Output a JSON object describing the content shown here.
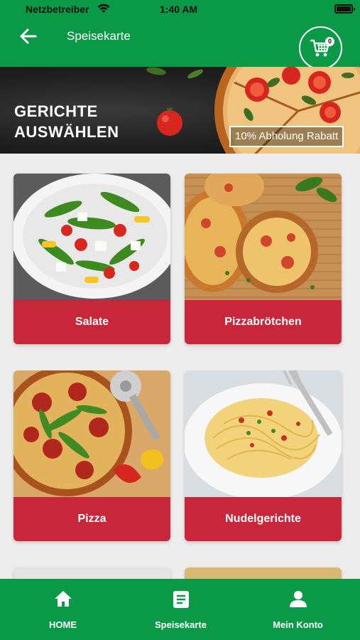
{
  "status_bar": {
    "carrier": "Netzbetreiber",
    "time": "1:40 AM"
  },
  "header": {
    "title": "Speisekarte",
    "cart_count": "0"
  },
  "banner": {
    "title_line1": "GERICHTE",
    "title_line2": "AUSWÄHLEN",
    "badge": "10% Abholung Rabatt"
  },
  "categories": [
    {
      "label": "Salate"
    },
    {
      "label": "Pizzabrötchen"
    },
    {
      "label": "Pizza"
    },
    {
      "label": "Nudelgerichte"
    }
  ],
  "nav": {
    "home": "HOME",
    "menu": "Speisekarte",
    "account": "Mein Konto"
  },
  "colors": {
    "brand_green": "#0a9a47",
    "category_red": "#c8263b"
  }
}
